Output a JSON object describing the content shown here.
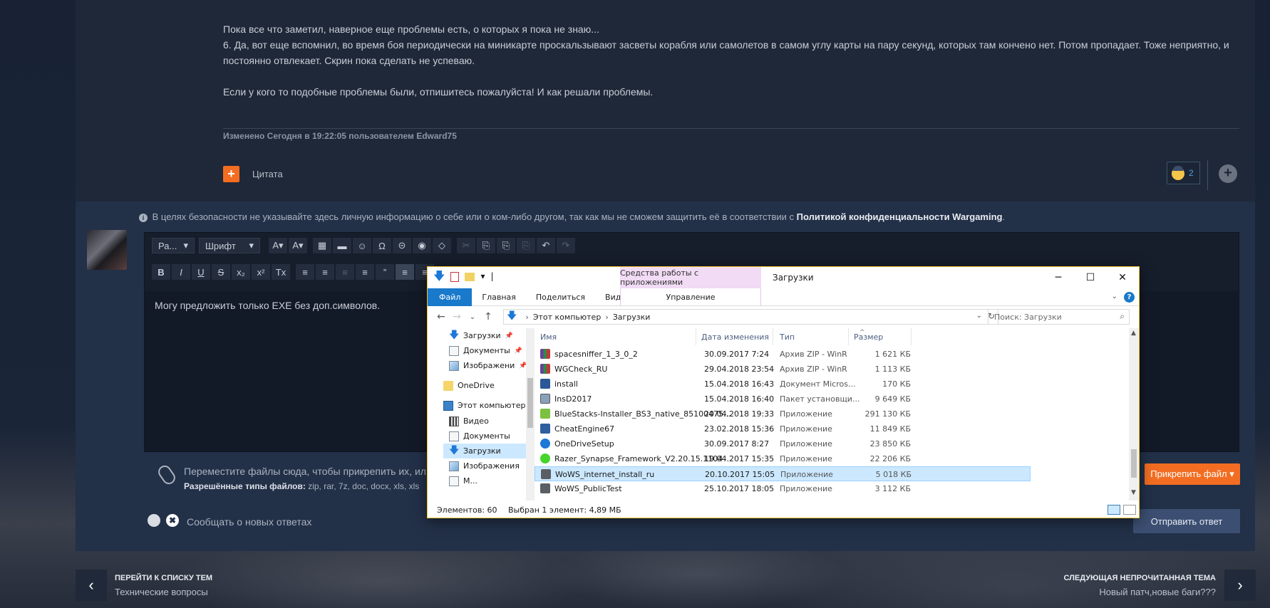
{
  "post": {
    "paragraphs": [
      "Пока все что заметил, наверное еще проблемы есть, о которых я пока не знаю...",
      "6. Да, вот еще вспомнил, во время боя периодически на миникарте проскальзывают засветы корабля или самолетов в самом углу карты на пару секунд, которых там кончено нет. Потом пропадает. Тоже неприятно, и постоянно отвлекает. Скрин пока сделать не успеваю.",
      "",
      "Если у кого то подобные проблемы были, отпишитесь пожалуйста! И как решали проблемы."
    ],
    "edited": "Изменено Сегодня в 19:22:05 пользователем Edward75",
    "quote_label": "Цитата",
    "quote_icon": "+",
    "reaction_count": "2",
    "more_icon": "+"
  },
  "reply": {
    "notice_icon": "i",
    "notice_text": "В целях безопасности не указывайте здесь личную информацию о себе или о ком-либо другом, так как мы не сможем защитить её в соответствии с",
    "notice_link": "Политикой конфиденциальности Wargaming",
    "notice_end": ".",
    "toolbar_row1": {
      "style_select": "Ра...",
      "font_select": "Шрифт",
      "buttons": [
        "A▾",
        "A▾",
        "▦",
        "▬",
        "☺",
        "Ω",
        "⊝",
        "◉",
        "◇",
        "✂",
        "⎘",
        "⎘",
        "⎘",
        "↶",
        "↷"
      ]
    },
    "toolbar_row2": {
      "buttons": [
        "B",
        "I",
        "U",
        "S",
        "x₂",
        "x²",
        "Tx",
        "≡",
        "≡",
        "≡",
        "≡",
        "”",
        "≡",
        "≡"
      ]
    },
    "editor_text": "Могу предложить только EXE без доп.символов.",
    "attach_text": "Переместите файлы сюда, чтобы прикрепить их, ил",
    "attach_types_label": "Разрешённые типы файлов:",
    "attach_types": "zip, rar, 7z, doc, docx, xls, xls",
    "attach_button": "Прикрепить файл ▾",
    "notify_toggle": "✖",
    "notify_label": "Сообщать о новых ответах",
    "send_button": "Отправить ответ"
  },
  "navigation": {
    "prev_arrow": "‹",
    "prev_title": "ПЕРЕЙТИ К СПИСКУ ТЕМ",
    "prev_sub": "Технические вопросы",
    "next_arrow": "›",
    "next_title": "СЛЕДУЮЩАЯ НЕПРОЧИТАННАЯ ТЕМА",
    "next_sub": "Новый патч,новые баги???"
  },
  "explorer": {
    "quick_access": {
      "down_icon": "🡇",
      "props_icon": "✓",
      "qa_dropdown": "▾",
      "qa_separator": "|"
    },
    "context_tab_header": "Средства работы с приложениями",
    "title": "Загрузки",
    "window_buttons": {
      "minimize": "─",
      "maximize": "☐",
      "close": "✕"
    },
    "ribbon_tabs": [
      "Файл",
      "Главная",
      "Поделиться",
      "Вид"
    ],
    "ribbon_manage": "Управление",
    "ribbon_expand": "⌄",
    "ribbon_help": "?",
    "nav_buttons": {
      "back": "←",
      "forward": "→",
      "recent": "⌄",
      "up": "↑"
    },
    "address": {
      "pc_icon": "🡇",
      "sep1": "›",
      "part1": "Этот компьютер",
      "sep2": "›",
      "part2": "Загрузки",
      "dropdown": "⌄",
      "refresh": "↻"
    },
    "search_placeholder": "Поиск: Загрузки",
    "search_icon": "⌕",
    "tree": [
      {
        "label": "Загрузки",
        "pin": "📌"
      },
      {
        "label": "Документы",
        "pin": "📌"
      },
      {
        "label": "Изображени",
        "pin": "📌"
      },
      {
        "label": "OneDrive"
      },
      {
        "label": "Этот компьютер"
      },
      {
        "label": "Видео"
      },
      {
        "label": "Документы"
      },
      {
        "label": "Загрузки"
      },
      {
        "label": "Изображения"
      },
      {
        "label": "М..."
      }
    ],
    "columns": {
      "name": "Имя",
      "date": "Дата изменения",
      "type": "Тип",
      "size": "Размер",
      "sort_icon": "^"
    },
    "files": [
      {
        "name": "spacesniffer_1_3_0_2",
        "date": "30.09.2017 7:24",
        "type": "Архив ZIP - WinR",
        "size": "1 621 КБ",
        "icon": "winrar-zip-icon"
      },
      {
        "name": "WGCheck_RU",
        "date": "29.04.2018 23:54",
        "type": "Архив ZIP - WinR",
        "size": "1 113 КБ",
        "icon": "winrar-zip-icon"
      },
      {
        "name": "install",
        "date": "15.04.2018 16:43",
        "type": "Документ Micros...",
        "size": "170 КБ",
        "icon": "word-doc-icon"
      },
      {
        "name": "InsD2017",
        "date": "15.04.2018 16:40",
        "type": "Пакет установщи...",
        "size": "9 649 КБ",
        "icon": "installer-package-icon"
      },
      {
        "name": "BlueStacks-Installer_BS3_native_85100475...",
        "date": "20.04.2018 19:33",
        "type": "Приложение",
        "size": "291 130 КБ",
        "icon": "bluestacks-icon"
      },
      {
        "name": "CheatEngine67",
        "date": "23.02.2018 15:36",
        "type": "Приложение",
        "size": "11 849 КБ",
        "icon": "cheatengine-icon"
      },
      {
        "name": "OneDriveSetup",
        "date": "30.09.2017 8:27",
        "type": "Приложение",
        "size": "23 850 КБ",
        "icon": "onedrive-icon"
      },
      {
        "name": "Razer_Synapse_Framework_V2.20.15.1104",
        "date": "19.04.2017 15:35",
        "type": "Приложение",
        "size": "22 206 КБ",
        "icon": "razer-icon"
      },
      {
        "name": "WoWS_internet_install_ru",
        "date": "20.10.2017 15:05",
        "type": "Приложение",
        "size": "5 018 КБ",
        "icon": "wows-icon"
      },
      {
        "name": "WoWS_PublicTest",
        "date": "25.10.2017 18:05",
        "type": "Приложение",
        "size": "3 112 КБ",
        "icon": "wows-icon"
      }
    ],
    "status_count": "Элементов: 60",
    "status_selected": "Выбран 1 элемент: 4,89 МБ"
  }
}
